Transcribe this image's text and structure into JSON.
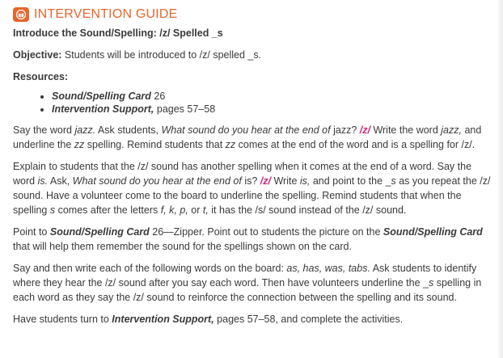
{
  "header": {
    "title": "INTERVENTION GUIDE",
    "logo_icon": "book-icon",
    "accent_color": "#e9652a"
  },
  "lesson_title": "Introduce the Sound/Spelling: /z/ Spelled _s",
  "objective": {
    "label": "Objective:",
    "text": " Students will be introduced to /z/ spelled _s."
  },
  "resources": {
    "heading": "Resources:",
    "items": [
      {
        "bold": "Sound/Spelling Card",
        "rest": " 26"
      },
      {
        "bold": "Intervention Support,",
        "rest": " pages 57–58"
      }
    ]
  },
  "phoneme_color": "#d6257a",
  "paragraphs": {
    "p1": {
      "a": "Say the word ",
      "b": "jazz.",
      "c": " Ask students, ",
      "d": "What sound do you hear at the end of",
      "e": " jazz? ",
      "f": "/z/",
      "g": " Write the word ",
      "h": "jazz,",
      "i": " and underline the ",
      "j": "zz",
      "k": " spelling. Remind students that ",
      "l": "zz",
      "m": " comes at the end of the word and is a spelling for /z/."
    },
    "p2": {
      "a": "Explain to students that the /z/ sound has another spelling when it comes at the end of a word. Say the word ",
      "b": "is.",
      "c": " Ask, ",
      "d": "What sound do you hear at the end of",
      "e": " is? ",
      "f": "/z/",
      "g": " Write ",
      "h": "is,",
      "i": " and point to the _",
      "j": "s",
      "k": " as you repeat the /z/ sound. Have a volunteer come to the board to underline the spelling. Remind students that when the spelling ",
      "l": "s",
      "m": " comes after the letters ",
      "n": "f, k, p,",
      "o": " or ",
      "p": "t,",
      "q": " it has the /s/ sound instead of the /z/ sound."
    },
    "p3": {
      "a": "Point to ",
      "b": "Sound/Spelling Card",
      "c": " 26—Zipper. Point out to students the picture on the ",
      "d": "Sound/Spelling Card",
      "e": " that will help them remember the sound for the spellings shown on the card."
    },
    "p4": {
      "a": "Say and then write each of the following words on the board: ",
      "b": "as, has, was, tabs.",
      "c": " Ask students to identify where they hear the /z/ sound after you say each word. Then have volunteers underline the _",
      "d": "s",
      "e": " spelling in each word as they say the /z/ sound to reinforce the connection between the spelling and its sound."
    },
    "p5": {
      "a": "Have students turn to ",
      "b": "Intervention Support,",
      "c": " pages 57–58, and complete the activities."
    }
  }
}
